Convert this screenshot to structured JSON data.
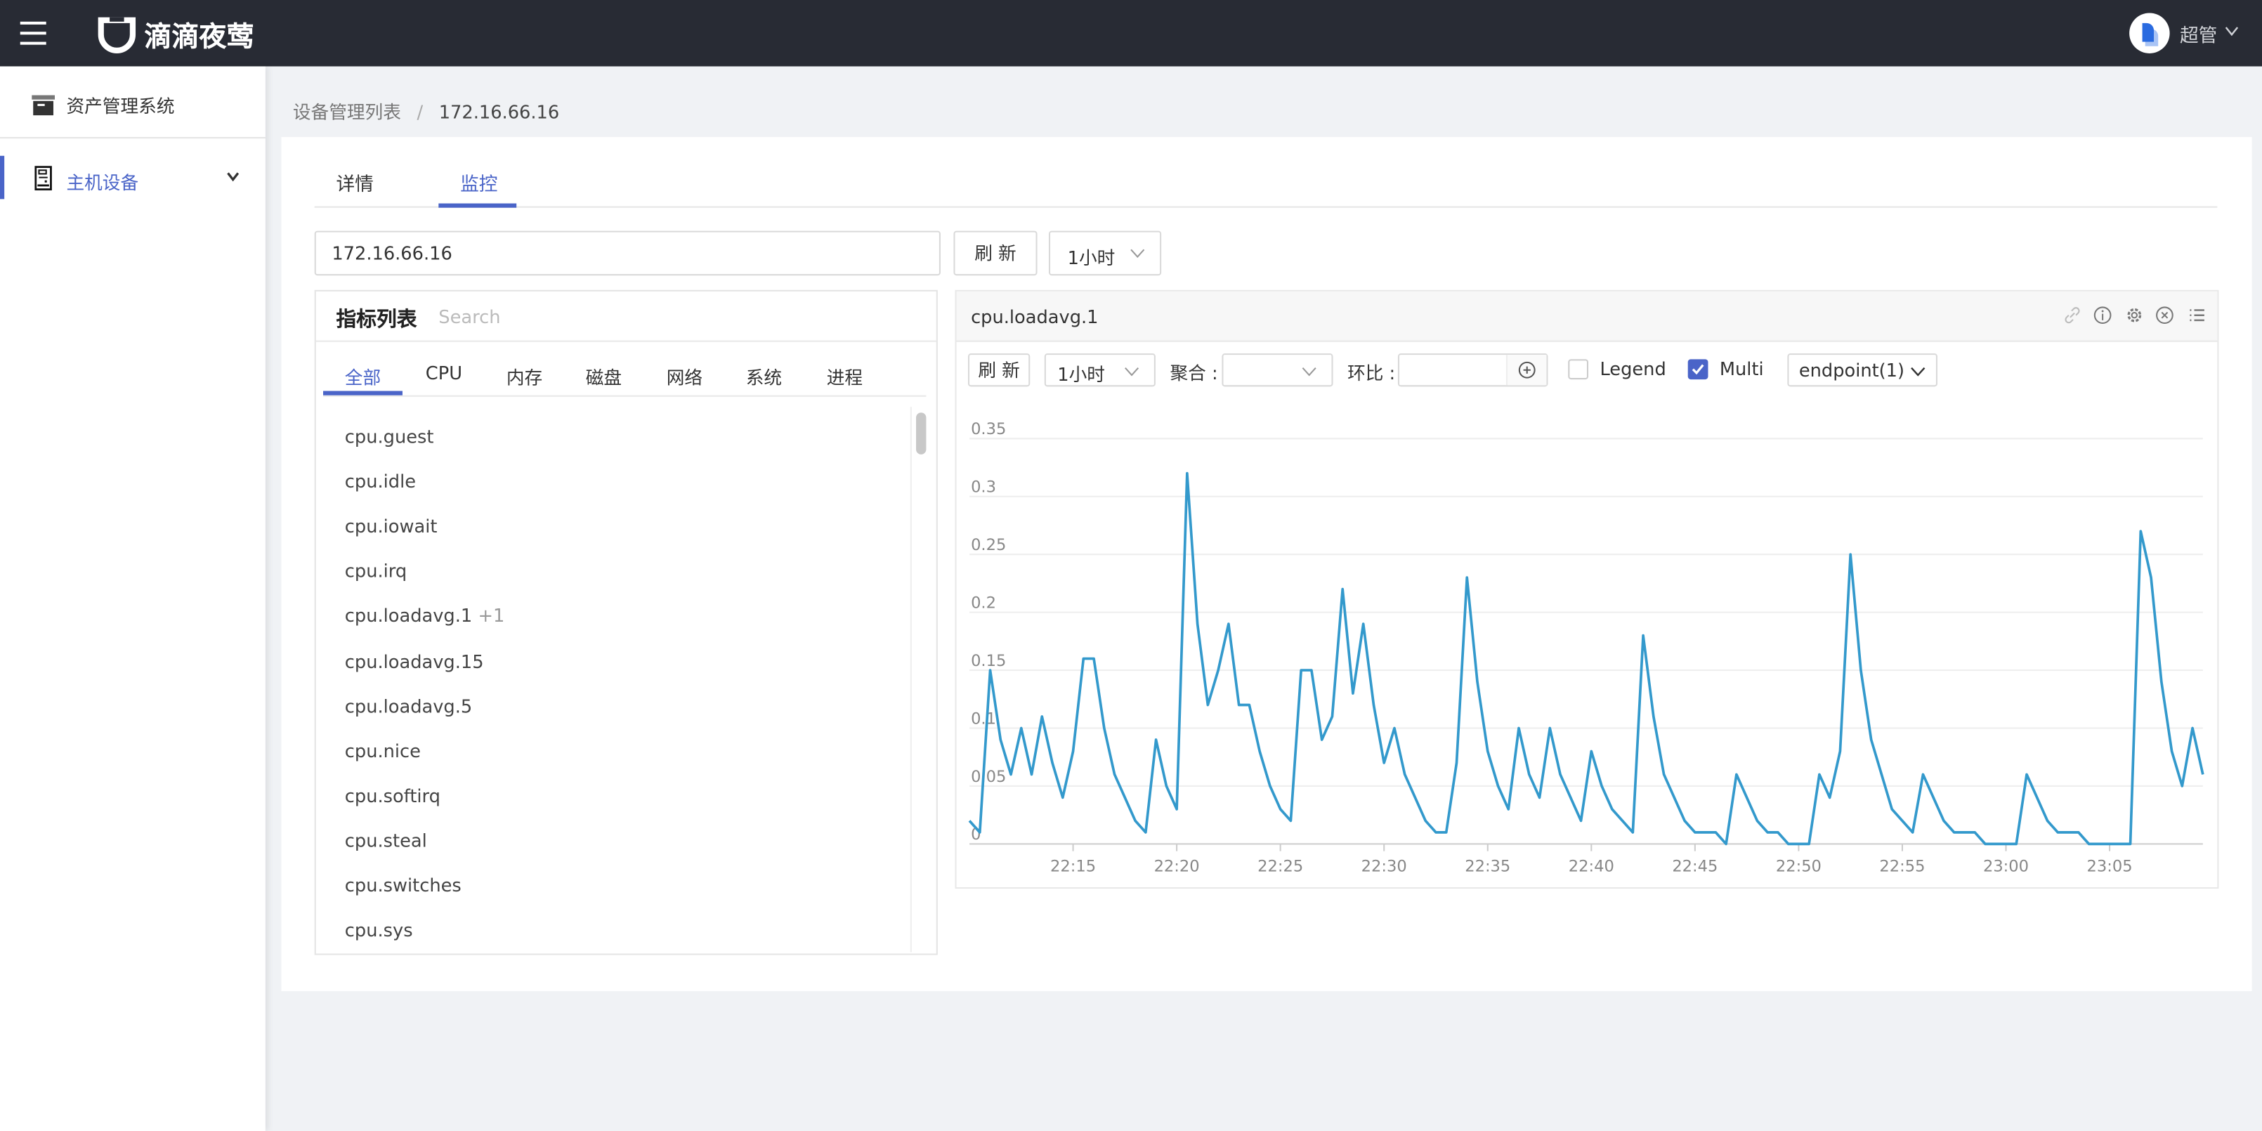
{
  "header": {
    "logo_text": "滴滴夜莺",
    "user_name": "超管",
    "icons": [
      "menu-icon",
      "logo-icon",
      "avatar",
      "chevron-down-icon"
    ]
  },
  "sidebar": {
    "items": [
      {
        "label": "资产管理系统",
        "icon": "archive-icon"
      },
      {
        "label": "主机设备",
        "icon": "server-icon",
        "active": true
      }
    ]
  },
  "breadcrumb": {
    "parent": "设备管理列表",
    "separator": "/",
    "current": "172.16.66.16"
  },
  "tabs": [
    {
      "label": "详情"
    },
    {
      "label": "监控",
      "active": true
    }
  ],
  "toolbar": {
    "endpoint_value": "172.16.66.16",
    "refresh_label": "刷 新",
    "range_value": "1小时"
  },
  "metric_panel": {
    "title": "指标列表",
    "search_placeholder": "Search",
    "tabs": [
      "全部",
      "CPU",
      "内存",
      "磁盘",
      "网络",
      "系统",
      "进程"
    ],
    "active_tab": "全部",
    "items": [
      {
        "name": "cpu.guest"
      },
      {
        "name": "cpu.idle"
      },
      {
        "name": "cpu.iowait"
      },
      {
        "name": "cpu.irq"
      },
      {
        "name": "cpu.loadavg.1",
        "badge": "+1"
      },
      {
        "name": "cpu.loadavg.15"
      },
      {
        "name": "cpu.loadavg.5"
      },
      {
        "name": "cpu.nice"
      },
      {
        "name": "cpu.softirq"
      },
      {
        "name": "cpu.steal"
      },
      {
        "name": "cpu.switches"
      },
      {
        "name": "cpu.sys"
      }
    ]
  },
  "chart_panel": {
    "title": "cpu.loadavg.1",
    "header_icons": [
      "link-icon",
      "info-icon",
      "gear-icon",
      "close-circle-icon",
      "list-icon"
    ],
    "refresh_label": "刷 新",
    "range_value": "1小时",
    "aggregate_label": "聚合 :",
    "aggregate_value": "",
    "compare_label": "环比 :",
    "compare_value": "",
    "legend_label": "Legend",
    "legend_checked": false,
    "multi_label": "Multi",
    "multi_checked": true,
    "endpoint_select": "endpoint(1)",
    "accent_color": "#4a64c8"
  },
  "chart_data": {
    "type": "line",
    "color": "#3399cc",
    "ylim": [
      0,
      0.35
    ],
    "yticks": [
      "0",
      "0.05",
      "0.1",
      "0.15",
      "0.2",
      "0.25",
      "0.3",
      "0.35"
    ],
    "xticks": [
      "22:15",
      "22:20",
      "22:25",
      "22:30",
      "22:35",
      "22:40",
      "22:45",
      "22:50",
      "22:55",
      "23:00",
      "23:05"
    ],
    "grid": true,
    "x": [
      "22:10:00",
      "22:10:30",
      "22:11:00",
      "22:11:30",
      "22:12:00",
      "22:12:30",
      "22:13:00",
      "22:13:30",
      "22:14:00",
      "22:14:30",
      "22:15:00",
      "22:15:30",
      "22:16:00",
      "22:16:30",
      "22:17:00",
      "22:17:30",
      "22:18:00",
      "22:18:30",
      "22:19:00",
      "22:19:30",
      "22:20:00",
      "22:20:30",
      "22:21:00",
      "22:21:30",
      "22:22:00",
      "22:22:30",
      "22:23:00",
      "22:23:30",
      "22:24:00",
      "22:24:30",
      "22:25:00",
      "22:25:30",
      "22:26:00",
      "22:26:30",
      "22:27:00",
      "22:27:30",
      "22:28:00",
      "22:28:30",
      "22:29:00",
      "22:29:30",
      "22:30:00",
      "22:30:30",
      "22:31:00",
      "22:31:30",
      "22:32:00",
      "22:32:30",
      "22:33:00",
      "22:33:30",
      "22:34:00",
      "22:34:30",
      "22:35:00",
      "22:35:30",
      "22:36:00",
      "22:36:30",
      "22:37:00",
      "22:37:30",
      "22:38:00",
      "22:38:30",
      "22:39:00",
      "22:39:30",
      "22:40:00",
      "22:40:30",
      "22:41:00",
      "22:41:30",
      "22:42:00",
      "22:42:30",
      "22:43:00",
      "22:43:30",
      "22:44:00",
      "22:44:30",
      "22:45:00",
      "22:45:30",
      "22:46:00",
      "22:46:30",
      "22:47:00",
      "22:47:30",
      "22:48:00",
      "22:48:30",
      "22:49:00",
      "22:49:30",
      "22:50:00",
      "22:50:30",
      "22:51:00",
      "22:51:30",
      "22:52:00",
      "22:52:30",
      "22:53:00",
      "22:53:30",
      "22:54:00",
      "22:54:30",
      "22:55:00",
      "22:55:30",
      "22:56:00",
      "22:56:30",
      "22:57:00",
      "22:57:30",
      "22:58:00",
      "22:58:30",
      "22:59:00",
      "22:59:30",
      "23:00:00",
      "23:00:30",
      "23:01:00",
      "23:01:30",
      "23:02:00",
      "23:02:30",
      "23:03:00",
      "23:03:30",
      "23:04:00",
      "23:04:30",
      "23:05:00",
      "23:05:30",
      "23:06:00",
      "23:06:30",
      "23:07:00",
      "23:07:30",
      "23:08:00",
      "23:08:30",
      "23:09:00",
      "23:09:30"
    ],
    "values": [
      0.02,
      0.01,
      0.15,
      0.09,
      0.06,
      0.1,
      0.06,
      0.11,
      0.07,
      0.04,
      0.08,
      0.16,
      0.16,
      0.1,
      0.06,
      0.04,
      0.02,
      0.01,
      0.09,
      0.05,
      0.03,
      0.32,
      0.19,
      0.12,
      0.15,
      0.19,
      0.12,
      0.12,
      0.08,
      0.05,
      0.03,
      0.02,
      0.15,
      0.15,
      0.09,
      0.11,
      0.22,
      0.13,
      0.19,
      0.12,
      0.07,
      0.1,
      0.06,
      0.04,
      0.02,
      0.01,
      0.01,
      0.07,
      0.23,
      0.14,
      0.08,
      0.05,
      0.03,
      0.1,
      0.06,
      0.04,
      0.1,
      0.06,
      0.04,
      0.02,
      0.08,
      0.05,
      0.03,
      0.02,
      0.01,
      0.18,
      0.11,
      0.06,
      0.04,
      0.02,
      0.01,
      0.01,
      0.01,
      0,
      0.06,
      0.04,
      0.02,
      0.01,
      0.01,
      0,
      0,
      0,
      0.06,
      0.04,
      0.08,
      0.25,
      0.15,
      0.09,
      0.06,
      0.03,
      0.02,
      0.01,
      0.06,
      0.04,
      0.02,
      0.01,
      0.01,
      0.01,
      0,
      0,
      0,
      0,
      0.06,
      0.04,
      0.02,
      0.01,
      0.01,
      0.01,
      0,
      0,
      0,
      0,
      0,
      0.27,
      0.23,
      0.14,
      0.08,
      0.05,
      0.1,
      0.06
    ]
  }
}
